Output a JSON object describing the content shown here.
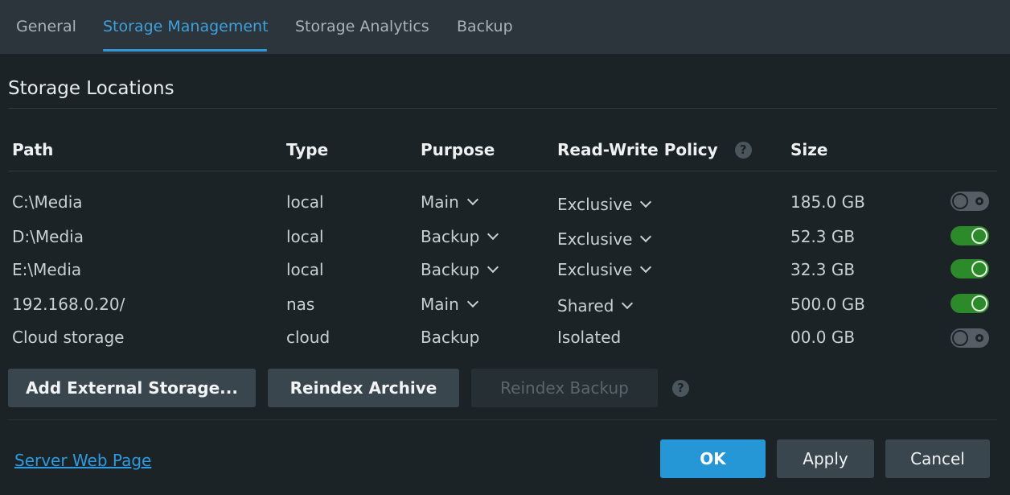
{
  "tabs": [
    {
      "label": "General",
      "active": false
    },
    {
      "label": "Storage Management",
      "active": true
    },
    {
      "label": "Storage Analytics",
      "active": false
    },
    {
      "label": "Backup",
      "active": false
    }
  ],
  "section_title": "Storage Locations",
  "columns": {
    "path": "Path",
    "type": "Type",
    "purpose": "Purpose",
    "policy": "Read-Write Policy",
    "size": "Size"
  },
  "help_glyph": "?",
  "rows": [
    {
      "path": "C:\\Media",
      "type": "local",
      "purpose": "Main",
      "purpose_dropdown": true,
      "policy": "Exclusive",
      "policy_dropdown": true,
      "size": "185.0 GB",
      "enabled": false
    },
    {
      "path": "D:\\Media",
      "type": "local",
      "purpose": "Backup",
      "purpose_dropdown": true,
      "policy": "Exclusive",
      "policy_dropdown": true,
      "size": "52.3 GB",
      "enabled": true
    },
    {
      "path": "E:\\Media",
      "type": "local",
      "purpose": "Backup",
      "purpose_dropdown": true,
      "policy": "Exclusive",
      "policy_dropdown": true,
      "size": "32.3 GB",
      "enabled": true
    },
    {
      "path": "192.168.0.20/",
      "type": "nas",
      "purpose": "Main",
      "purpose_dropdown": true,
      "policy": "Shared",
      "policy_dropdown": true,
      "size": "500.0 GB",
      "enabled": true
    },
    {
      "path": "Cloud storage",
      "type": "cloud",
      "purpose": "Backup",
      "purpose_dropdown": false,
      "policy": "Isolated",
      "policy_dropdown": false,
      "size": "00.0 GB",
      "enabled": false
    }
  ],
  "actions": {
    "add_external": "Add External Storage...",
    "reindex_archive": "Reindex Archive",
    "reindex_backup": "Reindex Backup"
  },
  "footer": {
    "server_link": "Server Web Page",
    "ok": "OK",
    "apply": "Apply",
    "cancel": "Cancel"
  },
  "colors": {
    "accent": "#2f97d8",
    "toggle_on": "#2c8a2a",
    "toggle_off": "#545e64",
    "background": "#1c2327"
  },
  "icons": {
    "help": "question-circle-icon",
    "dropdown": "chevron-down-icon",
    "toggle": "toggle-switch"
  }
}
